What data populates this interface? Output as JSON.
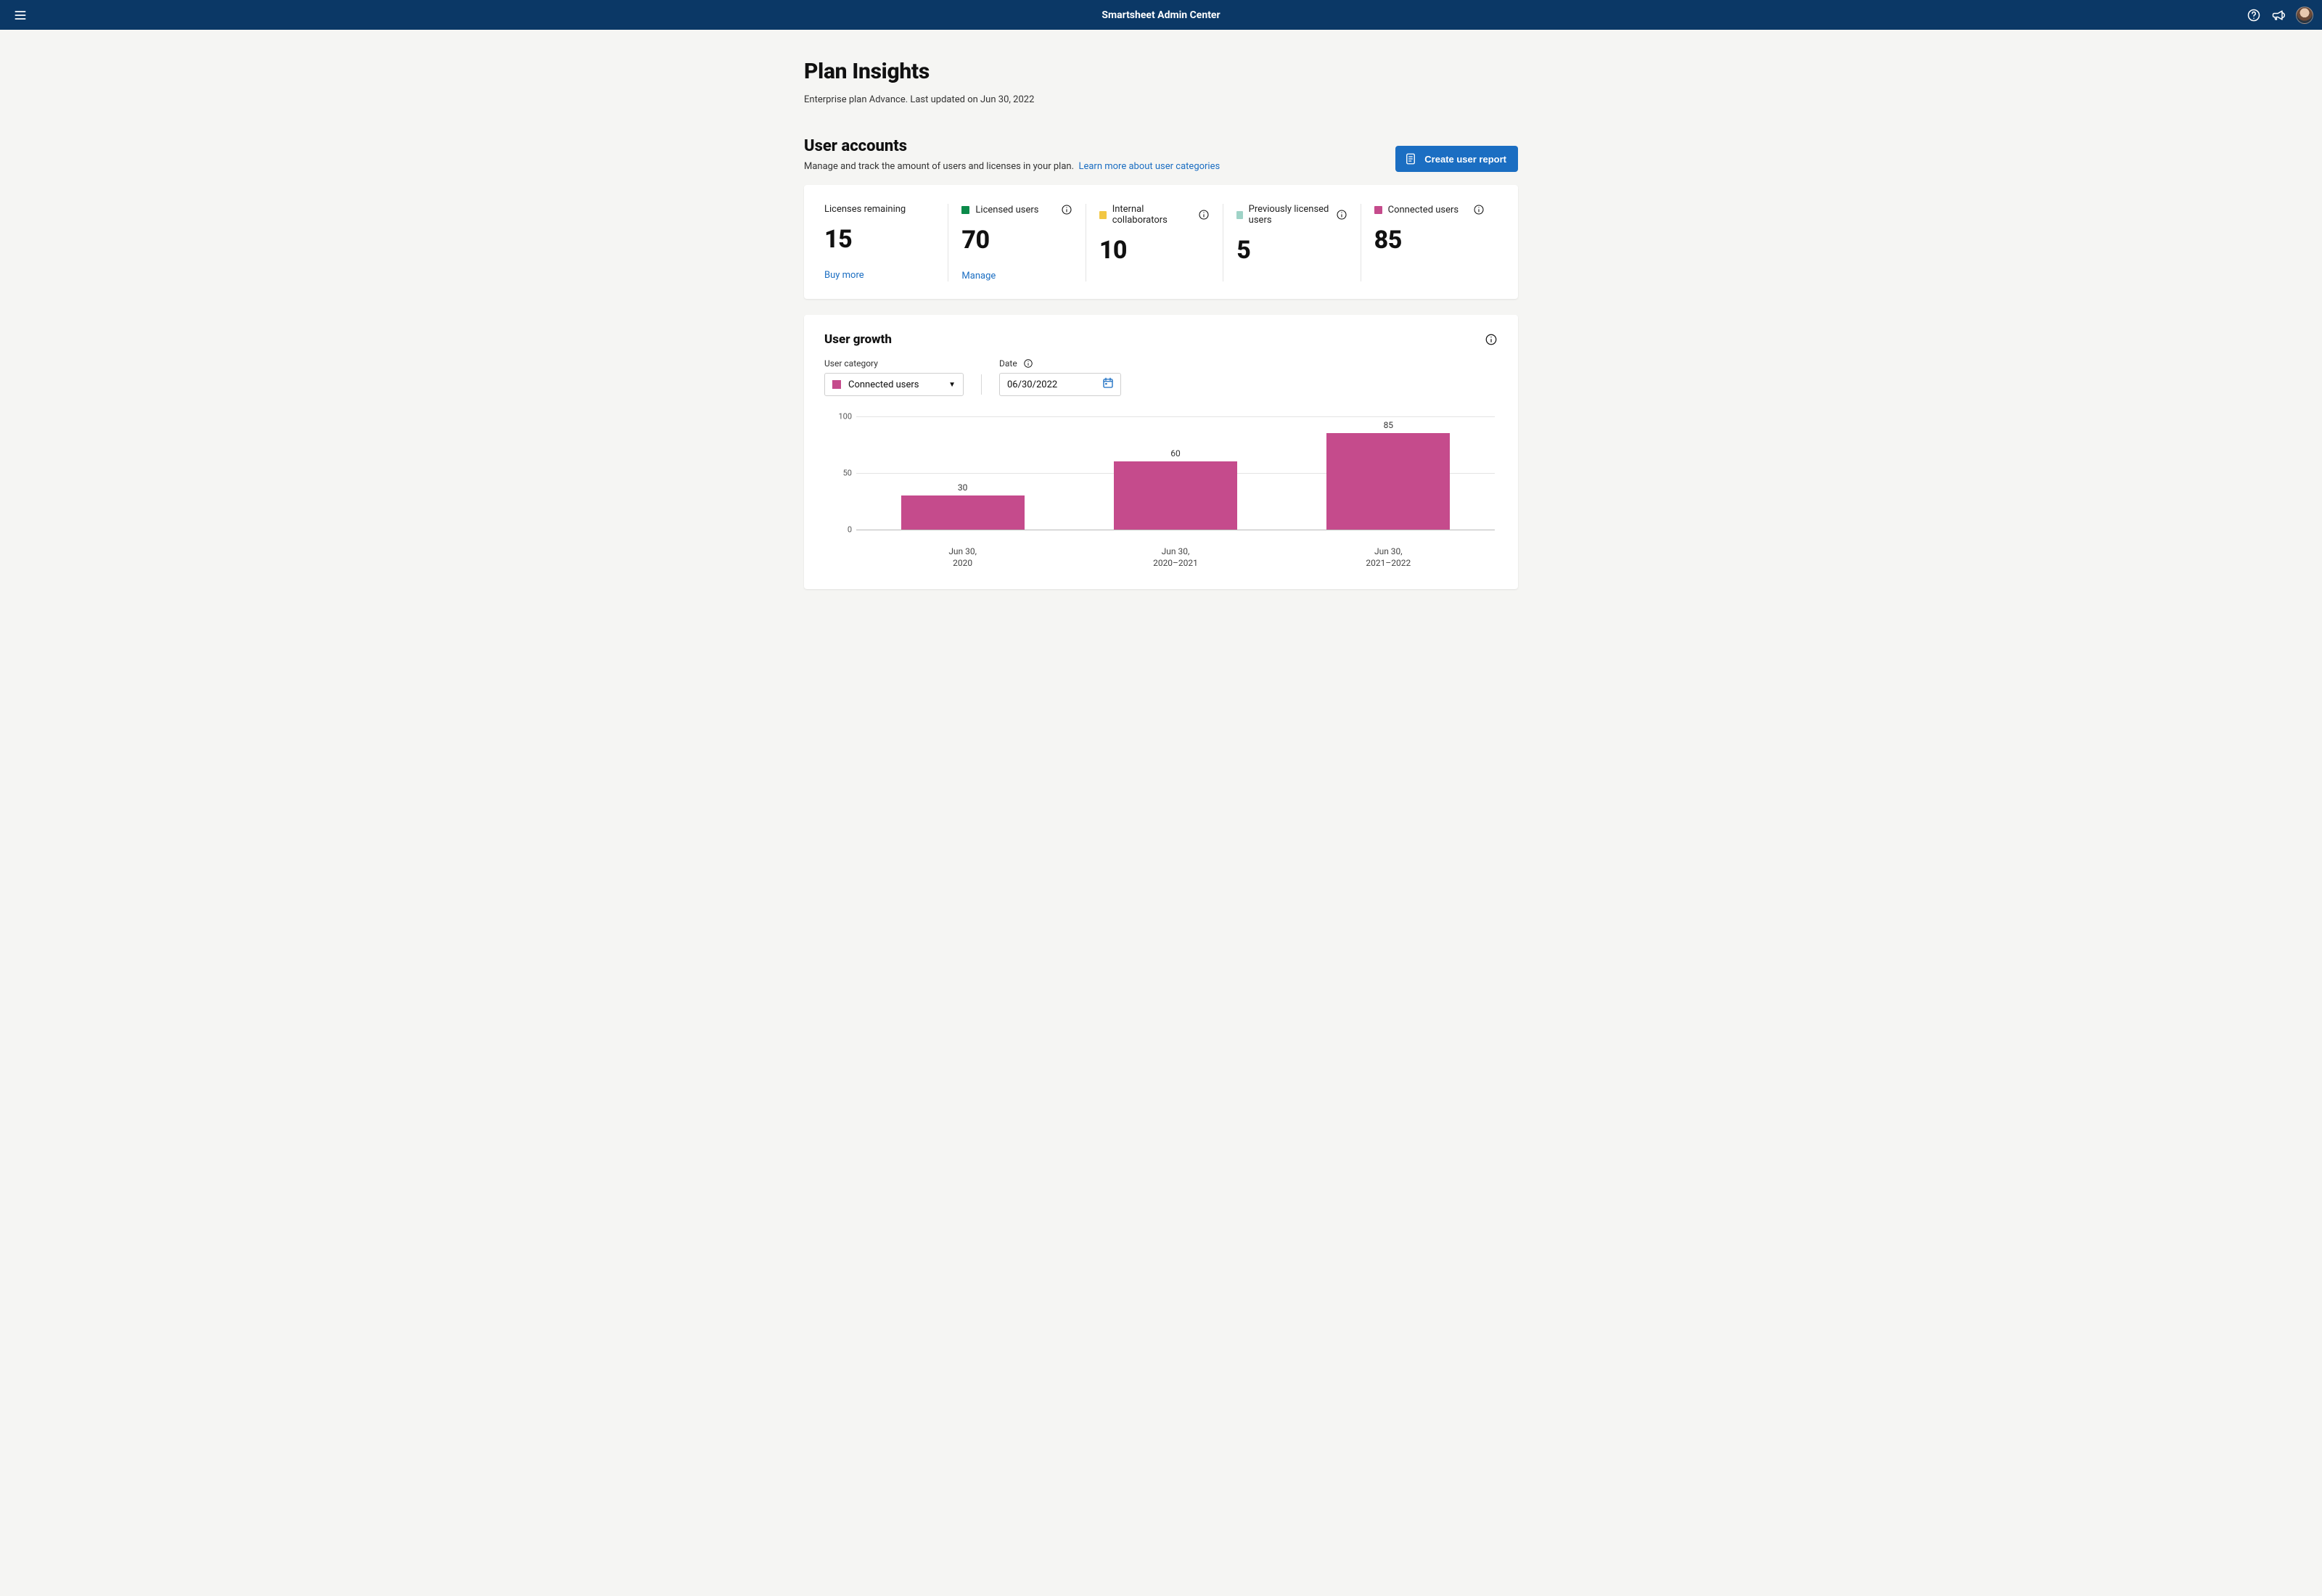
{
  "header": {
    "title": "Smartsheet Admin Center"
  },
  "page": {
    "title": "Plan Insights",
    "subtitle": "Enterprise plan Advance. Last updated on Jun 30, 2022"
  },
  "user_accounts": {
    "title": "User accounts",
    "description": "Manage and track the amount of users and licenses in your plan.",
    "learn_more": "Learn more about user categories",
    "create_report_label": "Create user report",
    "stats": {
      "licenses_remaining": {
        "label": "Licenses remaining",
        "value": "15",
        "link": "Buy more"
      },
      "licensed_users": {
        "label": "Licensed users",
        "value": "70",
        "link": "Manage"
      },
      "internal_collab": {
        "label": "Internal collaborators",
        "value": "10"
      },
      "prev_licensed": {
        "label": "Previously licensed users",
        "value": "5"
      },
      "connected_users": {
        "label": "Connected users",
        "value": "85"
      }
    }
  },
  "user_growth": {
    "title": "User growth",
    "category_label": "User category",
    "date_label": "Date",
    "selected_category": "Connected users",
    "selected_date": "06/30/2022"
  },
  "chart_data": {
    "type": "bar",
    "title": "User growth",
    "categories": [
      "Jun 30,\n2020",
      "Jun 30,\n2020–2021",
      "Jun 30,\n2021–2022"
    ],
    "values": [
      30,
      60,
      85
    ],
    "xlabel": "",
    "ylabel": "",
    "ylim": [
      0,
      100
    ],
    "yticks": [
      0,
      50,
      100
    ],
    "series_color": "#c54b8c"
  }
}
